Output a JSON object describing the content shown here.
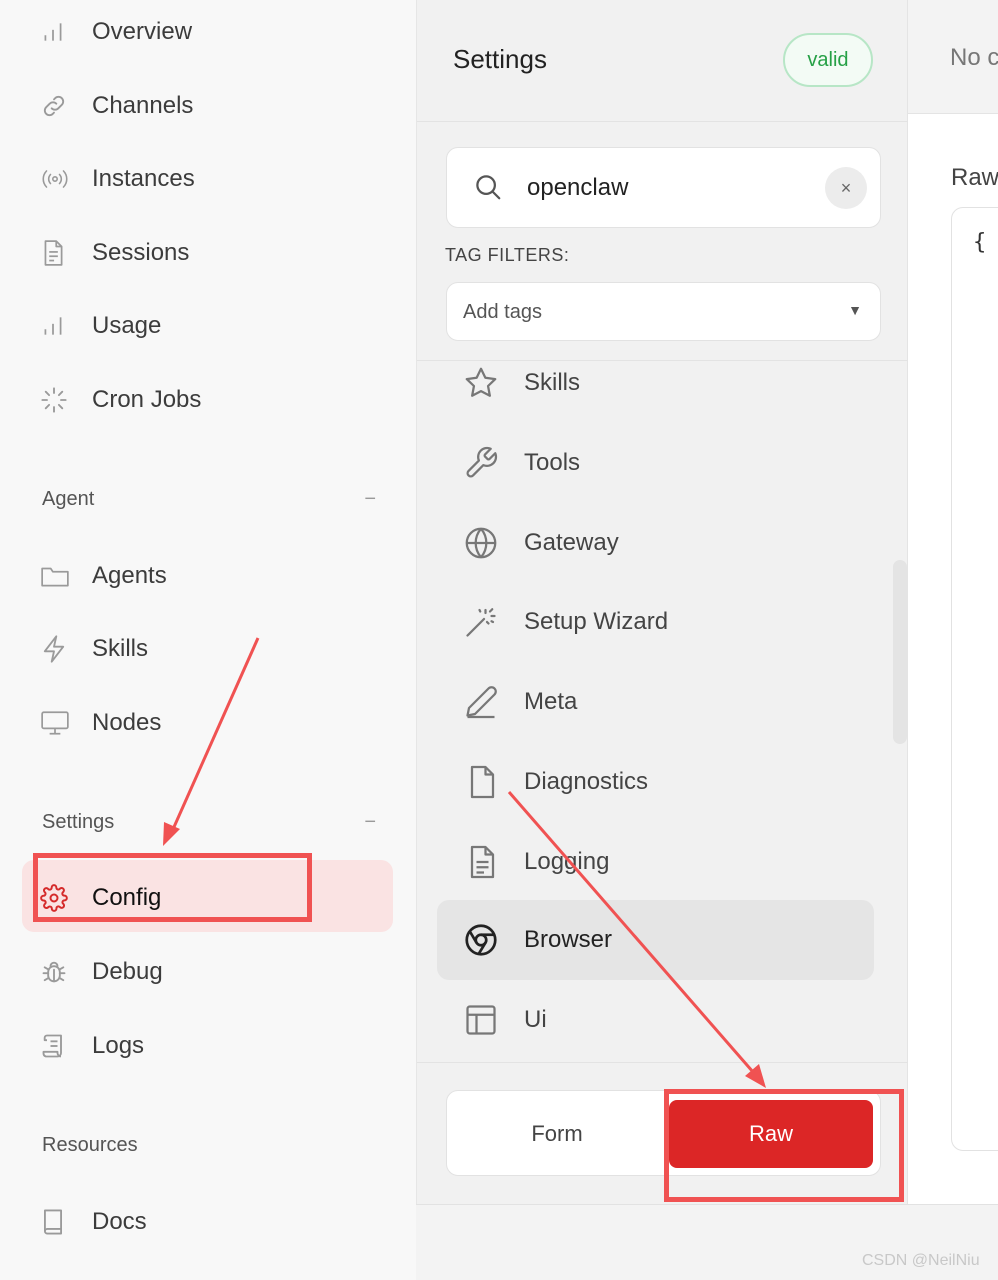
{
  "sidebar": {
    "items_top": [
      {
        "label": "Overview",
        "icon": "bar-chart-icon"
      },
      {
        "label": "Channels",
        "icon": "link-icon"
      },
      {
        "label": "Instances",
        "icon": "radio-signal-icon"
      },
      {
        "label": "Sessions",
        "icon": "document-icon"
      },
      {
        "label": "Usage",
        "icon": "bar-chart-icon"
      },
      {
        "label": "Cron Jobs",
        "icon": "loader-icon"
      }
    ],
    "agent_group": {
      "title": "Agent",
      "collapse": "−",
      "items": [
        {
          "label": "Agents",
          "icon": "folder-icon"
        },
        {
          "label": "Skills",
          "icon": "lightning-icon"
        },
        {
          "label": "Nodes",
          "icon": "monitor-icon"
        }
      ]
    },
    "settings_group": {
      "title": "Settings",
      "collapse": "−",
      "items": [
        {
          "label": "Config",
          "icon": "gear-icon",
          "active": true
        },
        {
          "label": "Debug",
          "icon": "bug-icon"
        },
        {
          "label": "Logs",
          "icon": "scroll-icon"
        }
      ]
    },
    "resources_group": {
      "title": "Resources",
      "items": [
        {
          "label": "Docs",
          "icon": "book-icon"
        }
      ]
    }
  },
  "settings_panel": {
    "title": "Settings",
    "status_badge": "valid",
    "search": {
      "value": "openclaw",
      "clear": "×"
    },
    "tag_filters_label": "TAG FILTERS:",
    "tag_select": {
      "placeholder": "Add tags",
      "caret": "▼"
    },
    "sections": [
      {
        "label": "Skills",
        "icon": "star-icon"
      },
      {
        "label": "Tools",
        "icon": "wrench-icon"
      },
      {
        "label": "Gateway",
        "icon": "globe-icon"
      },
      {
        "label": "Setup Wizard",
        "icon": "magic-wand-icon"
      },
      {
        "label": "Meta",
        "icon": "pencil-icon"
      },
      {
        "label": "Diagnostics",
        "icon": "file-icon"
      },
      {
        "label": "Logging",
        "icon": "file-text-icon"
      },
      {
        "label": "Browser",
        "icon": "chrome-icon",
        "active": true
      },
      {
        "label": "Ui",
        "icon": "layout-icon"
      }
    ],
    "mode_toggle": {
      "form": "Form",
      "raw": "Raw",
      "selected": "Raw"
    }
  },
  "raw_pane": {
    "top_text": "No c",
    "title": "Raw",
    "code": "{"
  },
  "annotations": {
    "color": "#f05252"
  },
  "watermark": "CSDN @NeilNiu",
  "colors": {
    "accent": "#dc2626",
    "active_bg": "#fae3e3",
    "valid": "#26a046"
  }
}
